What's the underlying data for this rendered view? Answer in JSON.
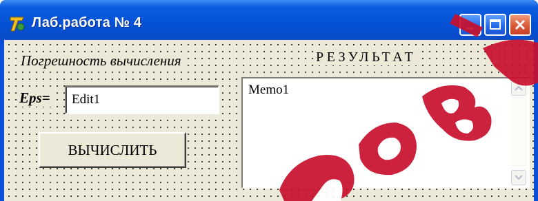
{
  "window": {
    "title": "Лаб.работа № 4",
    "icon": "app-icon",
    "controls": [
      "minimize-icon",
      "maximize-icon",
      "close-icon"
    ]
  },
  "form": {
    "error_label": "Погрешность вычисления",
    "result_label": "РЕЗУЛЬТАТ",
    "eps_label": "Eps=",
    "eps_value": "Edit1",
    "calc_button": "ВЫЧИСЛИТЬ",
    "memo_text": "Memo1"
  },
  "colors": {
    "titlebar": "#0551d6",
    "form_bg": "#ece9d8",
    "close_button": "#d85a35",
    "watermark": "#c8102e"
  }
}
